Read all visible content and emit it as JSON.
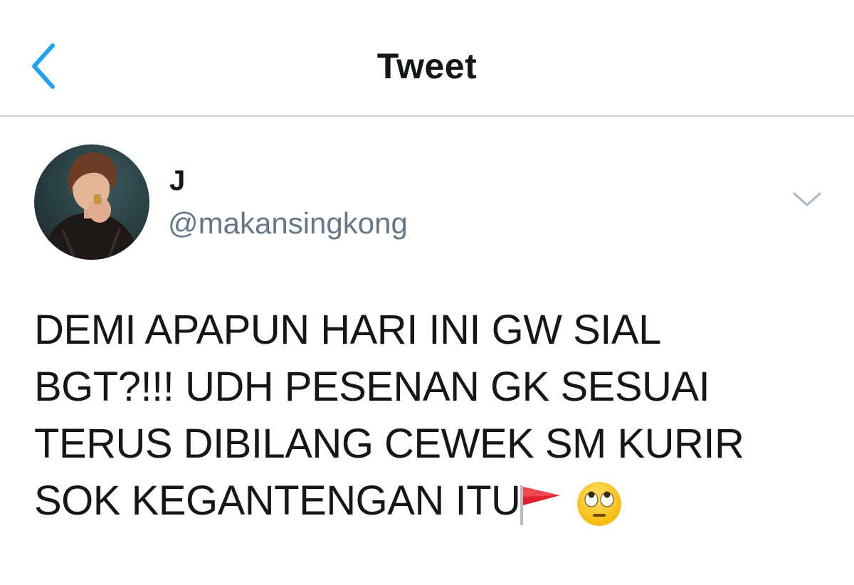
{
  "header": {
    "title": "Tweet",
    "back_icon": "chevron-left-icon"
  },
  "author": {
    "display_name": "J",
    "username": "@makansingkong",
    "avatar_icon": "profile-photo"
  },
  "menu": {
    "icon": "chevron-down-icon"
  },
  "tweet": {
    "lines": [
      "DEMI APAPUN HARI INI GW SIAL",
      "BGT?!!! UDH PESENAN GK SESUAI",
      "TERUS DIBILANG CEWEK SM KURIR",
      "SOK KEGANTENGAN ITU"
    ],
    "emojis": [
      "triangular-flag-emoji",
      "face-with-rolling-eyes-emoji"
    ]
  },
  "colors": {
    "accent": "#1da1f2",
    "text": "#14171a",
    "secondary": "#657786",
    "divider": "#cfd5da",
    "flag": "#e0202a"
  }
}
